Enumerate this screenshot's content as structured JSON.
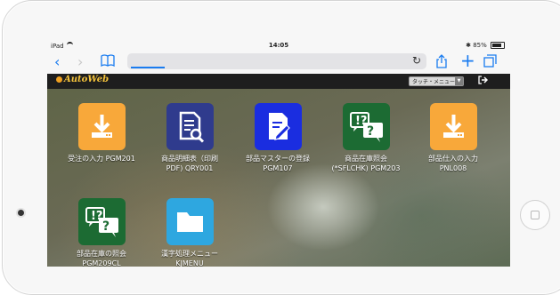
{
  "status": {
    "carrier": "iPad",
    "time": "14:05",
    "battery": "85%"
  },
  "browser": {
    "back_icon": "chevron-left-icon",
    "share_icon": "share-icon",
    "add_icon": "plus-icon",
    "tabs_icon": "tabs-icon"
  },
  "app": {
    "logo_text": "AutoWeb",
    "menu_select": "タッチ・メニュー",
    "tiles": [
      {
        "label": "受注の入力 PGM201",
        "color": "#f8a83a",
        "icon": "download-icon"
      },
      {
        "label": "商品明細表（印刷\nPDF) QRY001",
        "color": "#2f3b8d",
        "icon": "document-search-icon"
      },
      {
        "label": "部品マスターの登録\nPGM107",
        "color": "#1a2de0",
        "icon": "edit-document-icon"
      },
      {
        "label": "商品在庫照会\n(*SFLCHK) PGM203",
        "color": "#1c6b33",
        "icon": "question-chat-icon"
      },
      {
        "label": "部品仕入の入力\nPNL008",
        "color": "#f8a83a",
        "icon": "download-icon"
      },
      {
        "label": "部品在庫の照会\nPGM209CL",
        "color": "#1c6b33",
        "icon": "question-chat-icon"
      },
      {
        "label": "漢字処理メニュー\nKJMENU",
        "color": "#2ea7e0",
        "icon": "folder-icon"
      }
    ]
  }
}
